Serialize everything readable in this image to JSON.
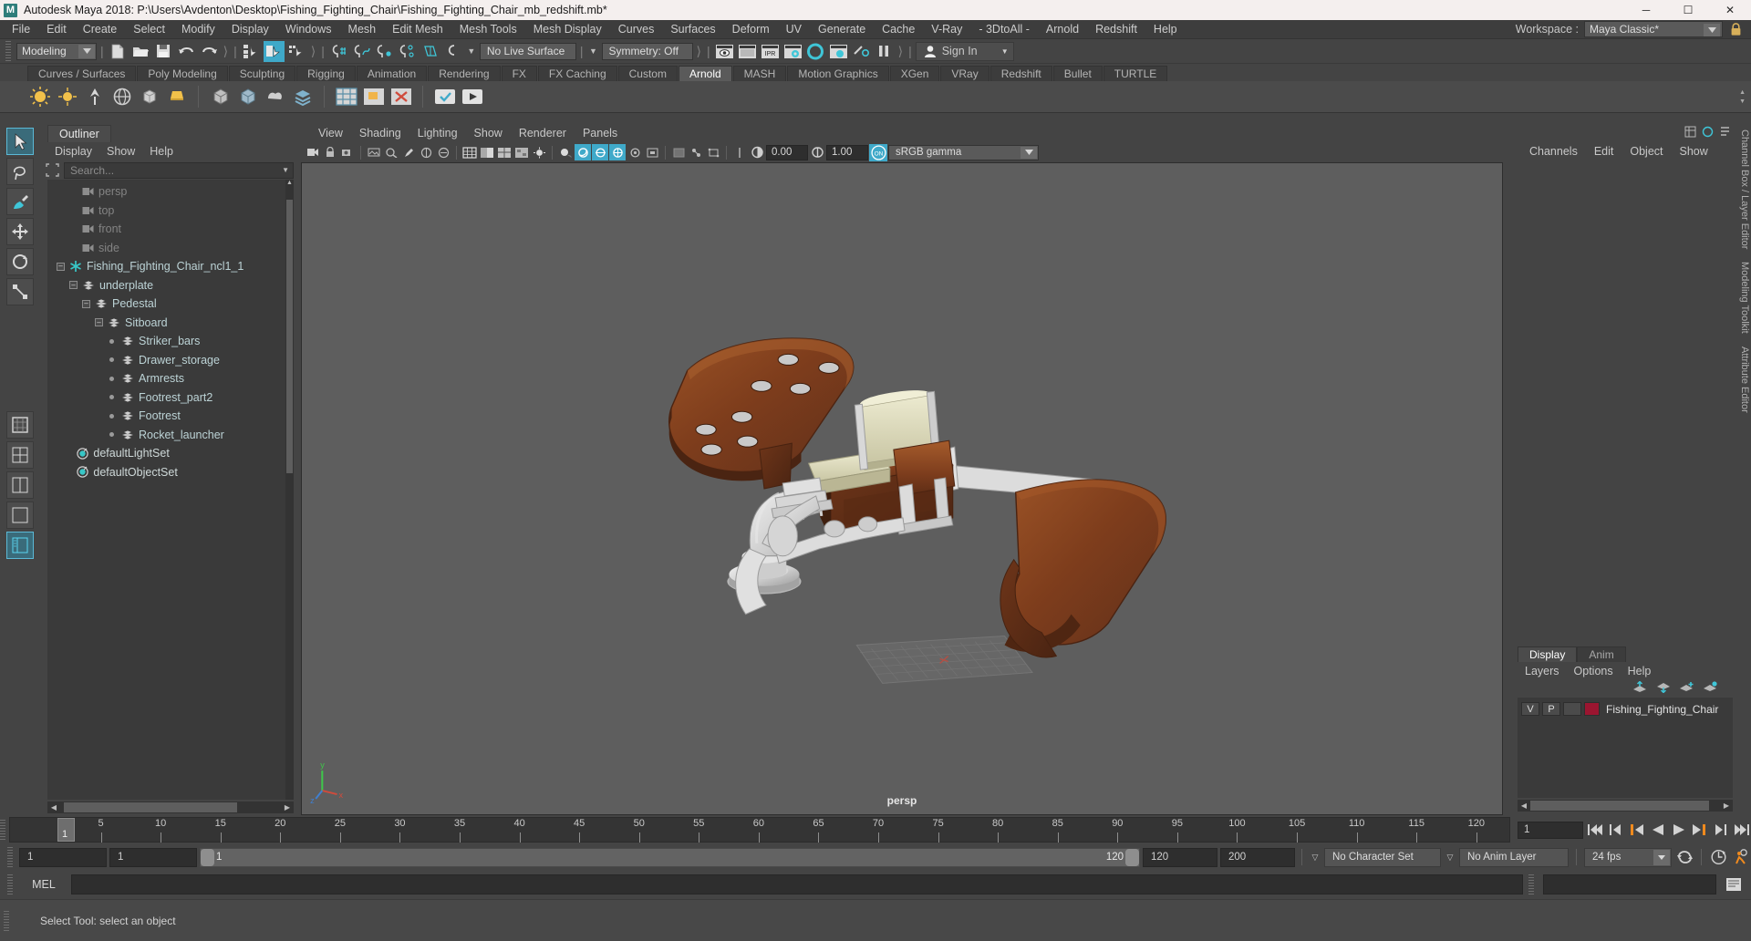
{
  "window": {
    "title": "Autodesk Maya 2018: P:\\Users\\Avdenton\\Desktop\\Fishing_Fighting_Chair\\Fishing_Fighting_Chair_mb_redshift.mb*",
    "logo": "M",
    "minimize": "─",
    "maximize": "☐",
    "close": "✕"
  },
  "menubar": {
    "items": [
      "File",
      "Edit",
      "Create",
      "Select",
      "Modify",
      "Display",
      "Windows",
      "Mesh",
      "Edit Mesh",
      "Mesh Tools",
      "Mesh Display",
      "Curves",
      "Surfaces",
      "Deform",
      "UV",
      "Generate",
      "Cache",
      "V-Ray",
      "- 3DtoAll -",
      "Arnold",
      "Redshift",
      "Help"
    ],
    "workspace_label": "Workspace :",
    "workspace_value": "Maya Classic*",
    "lock_icon": "lock-icon"
  },
  "statusbar": {
    "menu_set": "Modeling",
    "live_surface": "No Live Surface",
    "symmetry": "Symmetry: Off",
    "sign_in": "Sign In"
  },
  "shelf": {
    "tabs": [
      "Curves / Surfaces",
      "Poly Modeling",
      "Sculpting",
      "Rigging",
      "Animation",
      "Rendering",
      "FX",
      "FX Caching",
      "Custom",
      "Arnold",
      "MASH",
      "Motion Graphics",
      "XGen",
      "VRay",
      "Redshift",
      "Bullet",
      "TURTLE"
    ],
    "active_tab": "Arnold"
  },
  "outliner": {
    "tab": "Outliner",
    "menu": [
      "Display",
      "Show",
      "Help"
    ],
    "search_placeholder": "Search...",
    "tree": [
      {
        "label": "persp",
        "indent": 1,
        "icon": "camera-icon",
        "dim": true,
        "expander": null
      },
      {
        "label": "top",
        "indent": 1,
        "icon": "camera-icon",
        "dim": true,
        "expander": null
      },
      {
        "label": "front",
        "indent": 1,
        "icon": "camera-icon",
        "dim": true,
        "expander": null
      },
      {
        "label": "side",
        "indent": 1,
        "icon": "camera-icon",
        "dim": true,
        "expander": null
      },
      {
        "label": "Fishing_Fighting_Chair_ncl1_1",
        "indent": 0,
        "icon": "nucleus-icon",
        "dim": false,
        "expander": "-"
      },
      {
        "label": "underplate",
        "indent": 1,
        "icon": "mesh-icon",
        "dim": false,
        "expander": "-"
      },
      {
        "label": "Pedestal",
        "indent": 2,
        "icon": "mesh-icon",
        "dim": false,
        "expander": "-"
      },
      {
        "label": "Sitboard",
        "indent": 3,
        "icon": "mesh-icon",
        "dim": false,
        "expander": "-"
      },
      {
        "label": "Striker_bars",
        "indent": 4,
        "icon": "mesh-icon",
        "dim": false,
        "expander": "dot"
      },
      {
        "label": "Drawer_storage",
        "indent": 4,
        "icon": "mesh-icon",
        "dim": false,
        "expander": "dot"
      },
      {
        "label": "Armrests",
        "indent": 4,
        "icon": "mesh-icon",
        "dim": false,
        "expander": "dot"
      },
      {
        "label": "Footrest_part2",
        "indent": 4,
        "icon": "mesh-icon",
        "dim": false,
        "expander": "dot"
      },
      {
        "label": "Footrest",
        "indent": 4,
        "icon": "mesh-icon",
        "dim": false,
        "expander": "dot"
      },
      {
        "label": "Rocket_launcher",
        "indent": 4,
        "icon": "mesh-icon",
        "dim": false,
        "expander": "dot"
      },
      {
        "label": "defaultLightSet",
        "indent": 0.6,
        "icon": "set-icon",
        "dim": false,
        "expander": null
      },
      {
        "label": "defaultObjectSet",
        "indent": 0.6,
        "icon": "set-icon",
        "dim": false,
        "expander": null
      }
    ]
  },
  "viewport": {
    "menu": [
      "View",
      "Shading",
      "Lighting",
      "Show",
      "Renderer",
      "Panels"
    ],
    "exposure": "0.00",
    "gamma": "1.00",
    "color_profile": "sRGB gamma",
    "camera_label": "persp",
    "axis": {
      "x": "x",
      "y": "y",
      "z": "z"
    }
  },
  "channelbox": {
    "menu": [
      "Channels",
      "Edit",
      "Object",
      "Show"
    ],
    "side_tabs": [
      "Channel Box / Layer Editor",
      "Modeling Toolkit",
      "Attribute Editor"
    ]
  },
  "layer_editor": {
    "tabs": [
      "Display",
      "Anim"
    ],
    "active_tab": "Display",
    "menu": [
      "Layers",
      "Options",
      "Help"
    ],
    "icons": [
      "move-layer-up-icon",
      "move-layer-down-icon",
      "new-layer-icon",
      "new-layer-from-selected-icon"
    ],
    "layers": [
      {
        "visible": "V",
        "playback": "P",
        "type": "",
        "color": "#9b1530",
        "name": "Fishing_Fighting_Chair"
      }
    ]
  },
  "timeline": {
    "ticks": [
      5,
      10,
      15,
      20,
      25,
      30,
      35,
      40,
      45,
      50,
      55,
      60,
      65,
      70,
      75,
      80,
      85,
      90,
      95,
      100,
      105,
      110,
      115,
      120
    ],
    "current_frame": "1",
    "current_frame_field": "1",
    "end_label": "120",
    "playback_buttons": [
      "go-to-start-icon",
      "step-back-keyframe-icon",
      "step-back-frame-icon",
      "play-backwards-icon",
      "play-forwards-icon",
      "step-forward-frame-icon",
      "step-forward-keyframe-icon",
      "go-to-end-icon"
    ]
  },
  "range": {
    "start": "1",
    "anim_start": "1",
    "slider_start": "1",
    "slider_end": "120",
    "range_end": "120",
    "anim_end": "200",
    "character_set": "No Character Set",
    "anim_layer": "No Anim Layer",
    "fps": "24 fps",
    "icons": [
      "cycle-icon",
      "auto-keyframe-icon",
      "animation-preferences-icon"
    ]
  },
  "command_line": {
    "language": "MEL",
    "value": "",
    "placeholder": ""
  },
  "status_message": "Select Tool: select an object"
}
